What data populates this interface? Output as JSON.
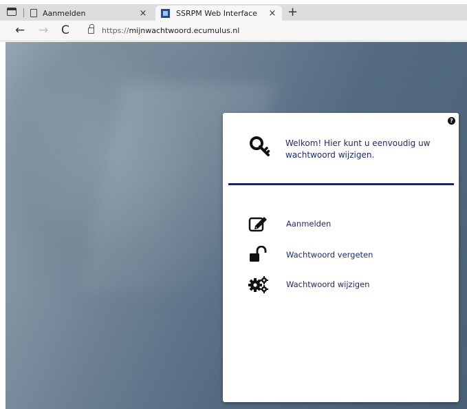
{
  "browser": {
    "tabs": [
      {
        "title": "Aanmelden",
        "close": "×",
        "active": false
      },
      {
        "title": "SSRPM Web Interface",
        "close": "×",
        "active": true
      }
    ],
    "new_tab": "+",
    "nav": {
      "back": "←",
      "forward": "→",
      "reload": "C"
    },
    "url_prefix": "https://",
    "url_domain": "mijnwachtwoord.ecumulus.nl"
  },
  "panel": {
    "help": "?",
    "welcome_text": "Welkom! Hier kunt u eenvoudig uw wachtwoord wijzigen.",
    "menu": [
      {
        "label": "Aanmelden",
        "icon": "edit-icon"
      },
      {
        "label": "Wachtwoord vergeten",
        "icon": "unlock-icon"
      },
      {
        "label": "Wachtwoord wijzigen",
        "icon": "gears-icon"
      }
    ]
  },
  "colors": {
    "accent": "#1b2260",
    "text": "#1f2a6b"
  }
}
